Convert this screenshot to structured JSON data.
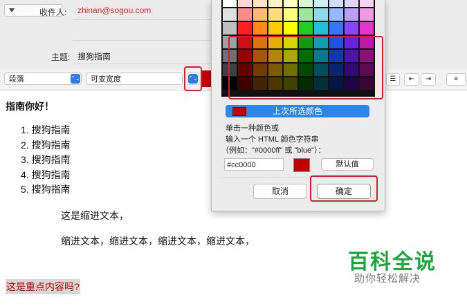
{
  "header": {
    "to_label": "收件人:",
    "to_value": "zhinan@sogou.com",
    "subject_label": "主题:",
    "subject_value": "搜狗指南"
  },
  "toolbar": {
    "paragraph_style": "段落",
    "font_name": "可变宽度",
    "stepper_glyph": "⌃⌄",
    "align_glyph": "≡",
    "indent_glyph": "⇤",
    "outdent_glyph": "⇥",
    "list_glyph": "☰"
  },
  "content": {
    "greeting": "指南你好！",
    "list_items": [
      "搜狗指南",
      "搜狗指南",
      "搜狗指南",
      "搜狗指南",
      "搜狗指南"
    ],
    "list_numbers": [
      "1.",
      "2.",
      "3.",
      "4.",
      "5."
    ],
    "indented_line_1": "这是缩进文本，",
    "indented_line_2": "缩进文本，缩进文本，缩进文本，缩进文本，",
    "highlight_text": "这是重点内容吗?"
  },
  "color_dialog": {
    "recent_button": "上次所选颜色",
    "hint_line_1": "单击一种颜色或",
    "hint_line_2": "输入一个 HTML 颜色字符串",
    "hint_line_3": "（例如：\"#0000ff\" 或 \"blue\"）：",
    "hex_value": "#cc0000",
    "default_button": "默认值",
    "cancel_button": "取消",
    "ok_button": "确定",
    "selected_color": "#cc0000",
    "palette_columns": 10,
    "palette": [
      [
        "#ffffff",
        "#ffd6d6",
        "#ffe4c8",
        "#fff3c2",
        "#ffffc8",
        "#d9f7d0",
        "#cdeff3",
        "#cfe0ff",
        "#e0d4ff",
        "#f7d4f2"
      ],
      [
        "#e0e0e0",
        "#ff8a8a",
        "#ffb878",
        "#ffdc78",
        "#ffff82",
        "#9be89b",
        "#8adcea",
        "#96b8ff",
        "#b8a0ff",
        "#f09ae6"
      ],
      [
        "#c0c0c0",
        "#ff2020",
        "#ff8c1a",
        "#ffcc00",
        "#ffff00",
        "#22cc22",
        "#22c0d8",
        "#3377ff",
        "#8844ff",
        "#e633cc"
      ],
      [
        "#a0a0a0",
        "#cc1010",
        "#e07010",
        "#e6b000",
        "#d8d800",
        "#119911",
        "#119fb5",
        "#1f55dd",
        "#6622dd",
        "#c01aa8"
      ],
      [
        "#707070",
        "#990000",
        "#aa5500",
        "#b38600",
        "#a8a800",
        "#006e00",
        "#007a8c",
        "#1338a8",
        "#4a14a6",
        "#8c0f7a"
      ],
      [
        "#404040",
        "#660000",
        "#733a00",
        "#7a5c00",
        "#707000",
        "#004a00",
        "#00505c",
        "#0a2470",
        "#300c70",
        "#5c0a52"
      ],
      [
        "#000000",
        "#3d0000",
        "#452200",
        "#4a3800",
        "#424200",
        "#002c00",
        "#003038",
        "#051445",
        "#1c0545",
        "#380632"
      ]
    ]
  },
  "watermark": {
    "main": "百科全说",
    "sub": "助你轻松解决"
  }
}
